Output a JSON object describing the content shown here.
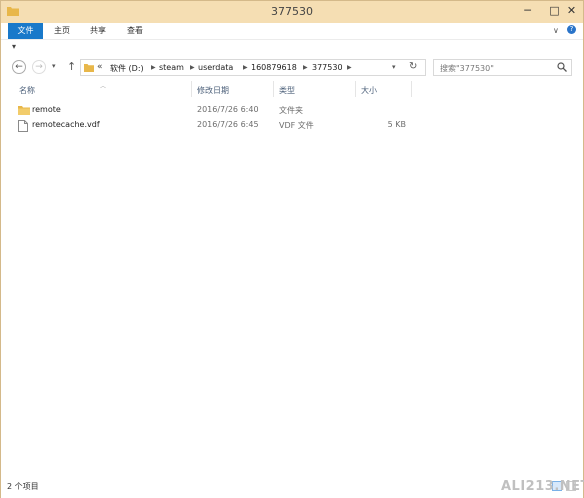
{
  "window": {
    "title": "377530"
  },
  "ribbon": {
    "tabs": [
      "文件",
      "主页",
      "共享",
      "查看"
    ]
  },
  "address": {
    "more": "«",
    "crumbs": [
      "软件 (D:)",
      "steam",
      "userdata",
      "160879618",
      "377530"
    ]
  },
  "search": {
    "placeholder": "搜索\"377530\""
  },
  "columns": {
    "name": "名称",
    "date": "修改日期",
    "type": "类型",
    "size": "大小"
  },
  "files": [
    {
      "icon": "folder-icon",
      "name": "remote",
      "date": "2016/7/26 6:40",
      "type": "文件夹",
      "size": ""
    },
    {
      "icon": "file-icon",
      "name": "remotecache.vdf",
      "date": "2016/7/26 6:45",
      "type": "VDF 文件",
      "size": "5 KB"
    }
  ],
  "status": {
    "count": "2 个项目"
  },
  "watermark": "ALI213.NET",
  "colors": {
    "accent": "#1979ca",
    "titlebar": "#f5deb3",
    "folder": "#e8b74a"
  }
}
